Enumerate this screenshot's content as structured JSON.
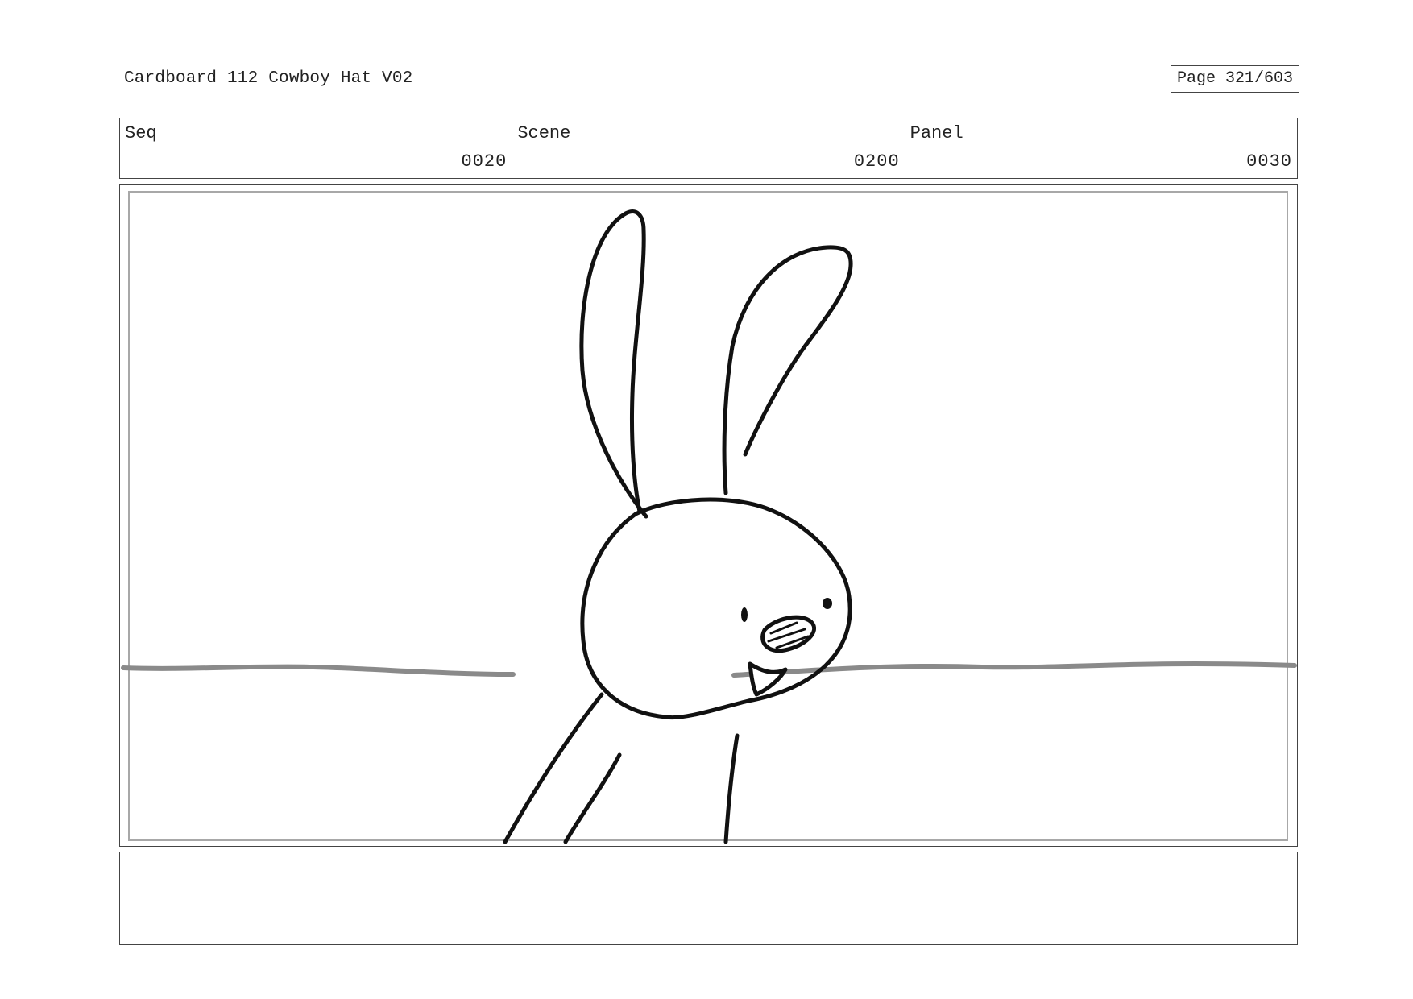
{
  "document": {
    "title": "Cardboard 112 Cowboy Hat V02",
    "page_label": "Page 321/603"
  },
  "info": {
    "seq_label": "Seq",
    "seq_value": "0020",
    "scene_label": "Scene",
    "scene_value": "0200",
    "panel_label": "Panel",
    "panel_value": "0030"
  },
  "notes": {
    "text": ""
  },
  "colors": {
    "line_art": "#111111",
    "horizon": "#8a8a8a",
    "frame_border": "#444444",
    "safe_area_border": "#a8a8a8"
  }
}
